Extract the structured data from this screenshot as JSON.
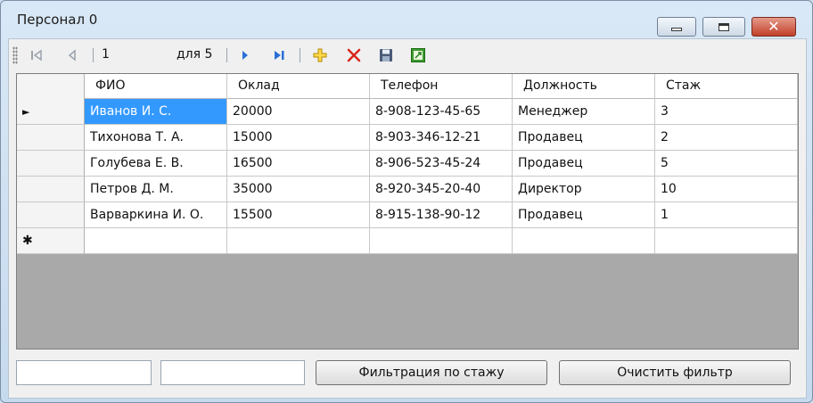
{
  "window": {
    "title": "Персонал 0"
  },
  "navigator": {
    "position": "1",
    "count_label": "для 5"
  },
  "icons": [
    "move-first-icon",
    "move-previous-icon",
    "move-next-icon",
    "move-last-icon",
    "add-icon",
    "delete-icon",
    "save-icon",
    "export-icon"
  ],
  "grid": {
    "columns": [
      "ФИО",
      "Оклад",
      "Телефон",
      "Должность",
      "Стаж"
    ],
    "rows": [
      [
        "Иванов И. С.",
        "20000",
        "8-908-123-45-65",
        "Менеджер",
        "3"
      ],
      [
        "Тихонова Т. А.",
        "15000",
        "8-903-346-12-21",
        "Продавец",
        "2"
      ],
      [
        "Голубева Е. В.",
        "16500",
        "8-906-523-45-24",
        "Продавец",
        "5"
      ],
      [
        "Петров Д. М.",
        "35000",
        "8-920-345-20-40",
        "Директор",
        "10"
      ],
      [
        "Варваркина И. О.",
        "15500",
        "8-915-138-90-12",
        "Продавец",
        "1"
      ]
    ],
    "current_row_marker": "►",
    "new_row_marker": "✱"
  },
  "footer": {
    "filter_button": "Фильтрация по стажу",
    "clear_button": "Очистить фильтр",
    "input1_value": "",
    "input2_value": ""
  },
  "colors": {
    "selection": "#3399ff",
    "grid_background": "#a9a9a9",
    "close_button": "#c2402a"
  }
}
